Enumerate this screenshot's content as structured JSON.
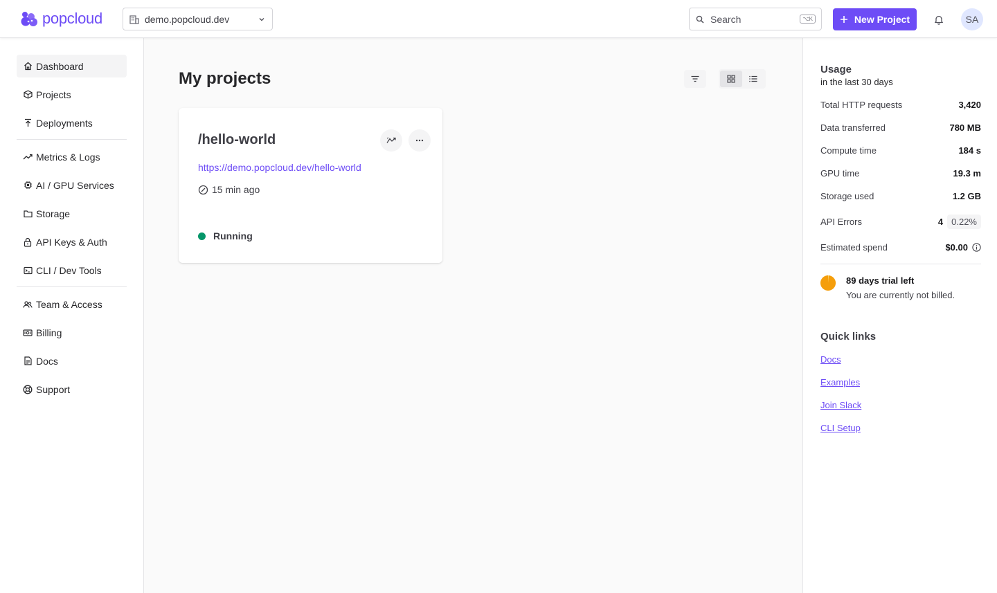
{
  "brand": {
    "name": "popcloud",
    "accent": "#6d4cf6"
  },
  "header": {
    "site_selector": "demo.popcloud.dev",
    "search_placeholder": "Search",
    "search_shortcut": "⌥K",
    "new_project_label": "New Project",
    "avatar_initials": "SA"
  },
  "sidebar": {
    "items": [
      {
        "label": "Dashboard",
        "icon": "home-icon",
        "active": true
      },
      {
        "label": "Projects",
        "icon": "cube-icon"
      },
      {
        "label": "Deployments",
        "icon": "upload-icon"
      },
      {
        "label": "Metrics & Logs",
        "icon": "chart-line-icon"
      },
      {
        "label": "AI / GPU Services",
        "icon": "chip-icon"
      },
      {
        "label": "Storage",
        "icon": "folder-icon"
      },
      {
        "label": "API Keys & Auth",
        "icon": "lock-icon"
      },
      {
        "label": "CLI / Dev Tools",
        "icon": "terminal-icon"
      },
      {
        "label": "Team & Access",
        "icon": "users-icon"
      },
      {
        "label": "Billing",
        "icon": "money-icon"
      },
      {
        "label": "Docs",
        "icon": "document-icon"
      },
      {
        "label": "Support",
        "icon": "lifebuoy-icon"
      }
    ]
  },
  "main": {
    "title": "My projects",
    "project": {
      "name": "/hello-world",
      "url": "https://demo.popcloud.dev/hello-world",
      "updated": "15 min ago",
      "status": "Running",
      "status_color": "#059669"
    }
  },
  "usage": {
    "title": "Usage",
    "subtitle": "in the last 30 days",
    "stats": [
      {
        "label": "Total HTTP requests",
        "value": "3,420"
      },
      {
        "label": "Data transferred",
        "value": "780 MB"
      },
      {
        "label": "Compute time",
        "value": "184 s"
      },
      {
        "label": "GPU time",
        "value": "19.3 m"
      },
      {
        "label": "Storage used",
        "value": "1.2 GB"
      },
      {
        "label": "API Errors",
        "value": "4",
        "pill": "0.22%"
      },
      {
        "label": "Estimated spend",
        "value": "$0.00"
      }
    ],
    "trial_title": "89 days trial left",
    "trial_sub": "You are currently not billed.",
    "trial_color": "#f59e0b"
  },
  "quick_links": {
    "title": "Quick links",
    "links": [
      "Docs",
      "Examples",
      "Join Slack",
      "CLI Setup"
    ]
  }
}
